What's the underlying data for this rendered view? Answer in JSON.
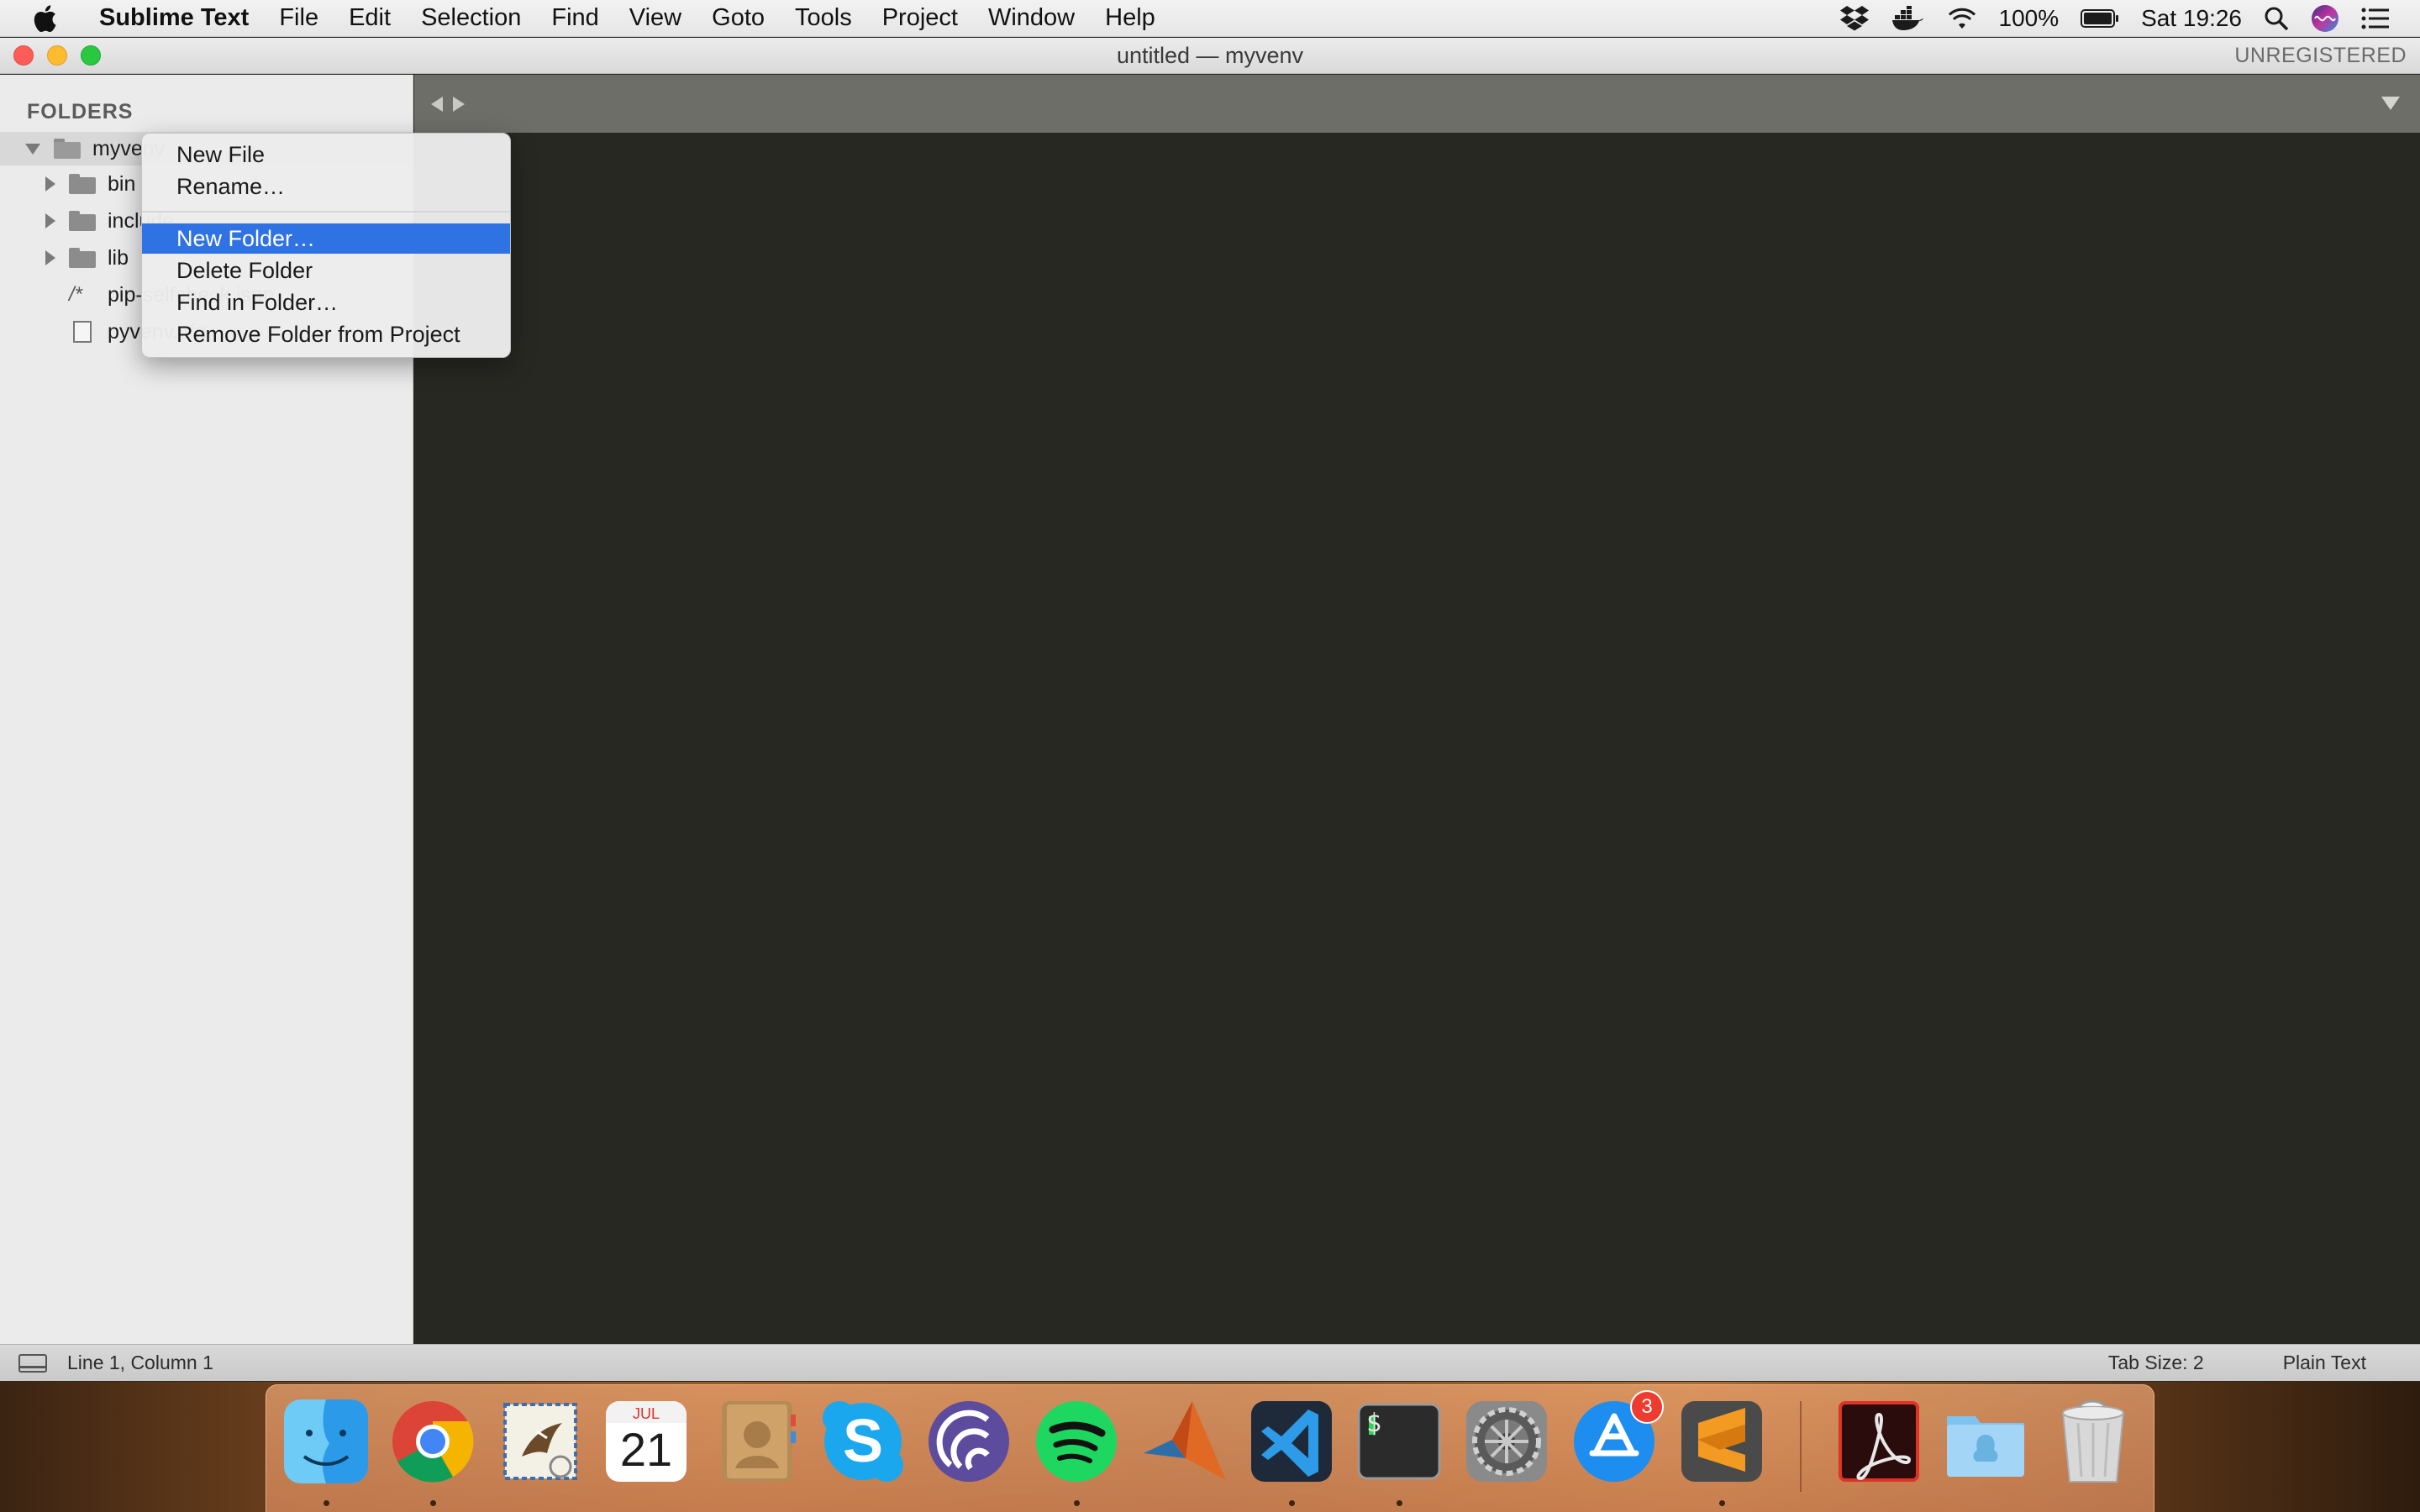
{
  "menubar": {
    "app_name": "Sublime Text",
    "items": [
      "File",
      "Edit",
      "Selection",
      "Find",
      "View",
      "Goto",
      "Tools",
      "Project",
      "Window",
      "Help"
    ],
    "battery": "100%",
    "clock": "Sat 19:26"
  },
  "window": {
    "title": "untitled — myvenv",
    "registration": "UNREGISTERED"
  },
  "sidebar": {
    "header": "FOLDERS",
    "root": "myvenv",
    "children": [
      "bin",
      "include",
      "lib",
      "pip-selfcheck.json",
      "pyvenv.cfg"
    ]
  },
  "context_menu": {
    "items": [
      "New File",
      "Rename…",
      "New Folder…",
      "Delete Folder",
      "Find in Folder…",
      "Remove Folder from Project"
    ],
    "selected": "New Folder…"
  },
  "statusbar": {
    "position": "Line 1, Column 1",
    "tab_size": "Tab Size: 2",
    "syntax": "Plain Text"
  },
  "dock": {
    "calendar_month": "JUL",
    "calendar_day": "21",
    "app_store_badge": "3",
    "terminal_prompt": "$"
  },
  "colors": {
    "editor_bg": "#272822",
    "tabbar_bg": "#6e6e69",
    "menu_highlight": "#2f72e3"
  }
}
